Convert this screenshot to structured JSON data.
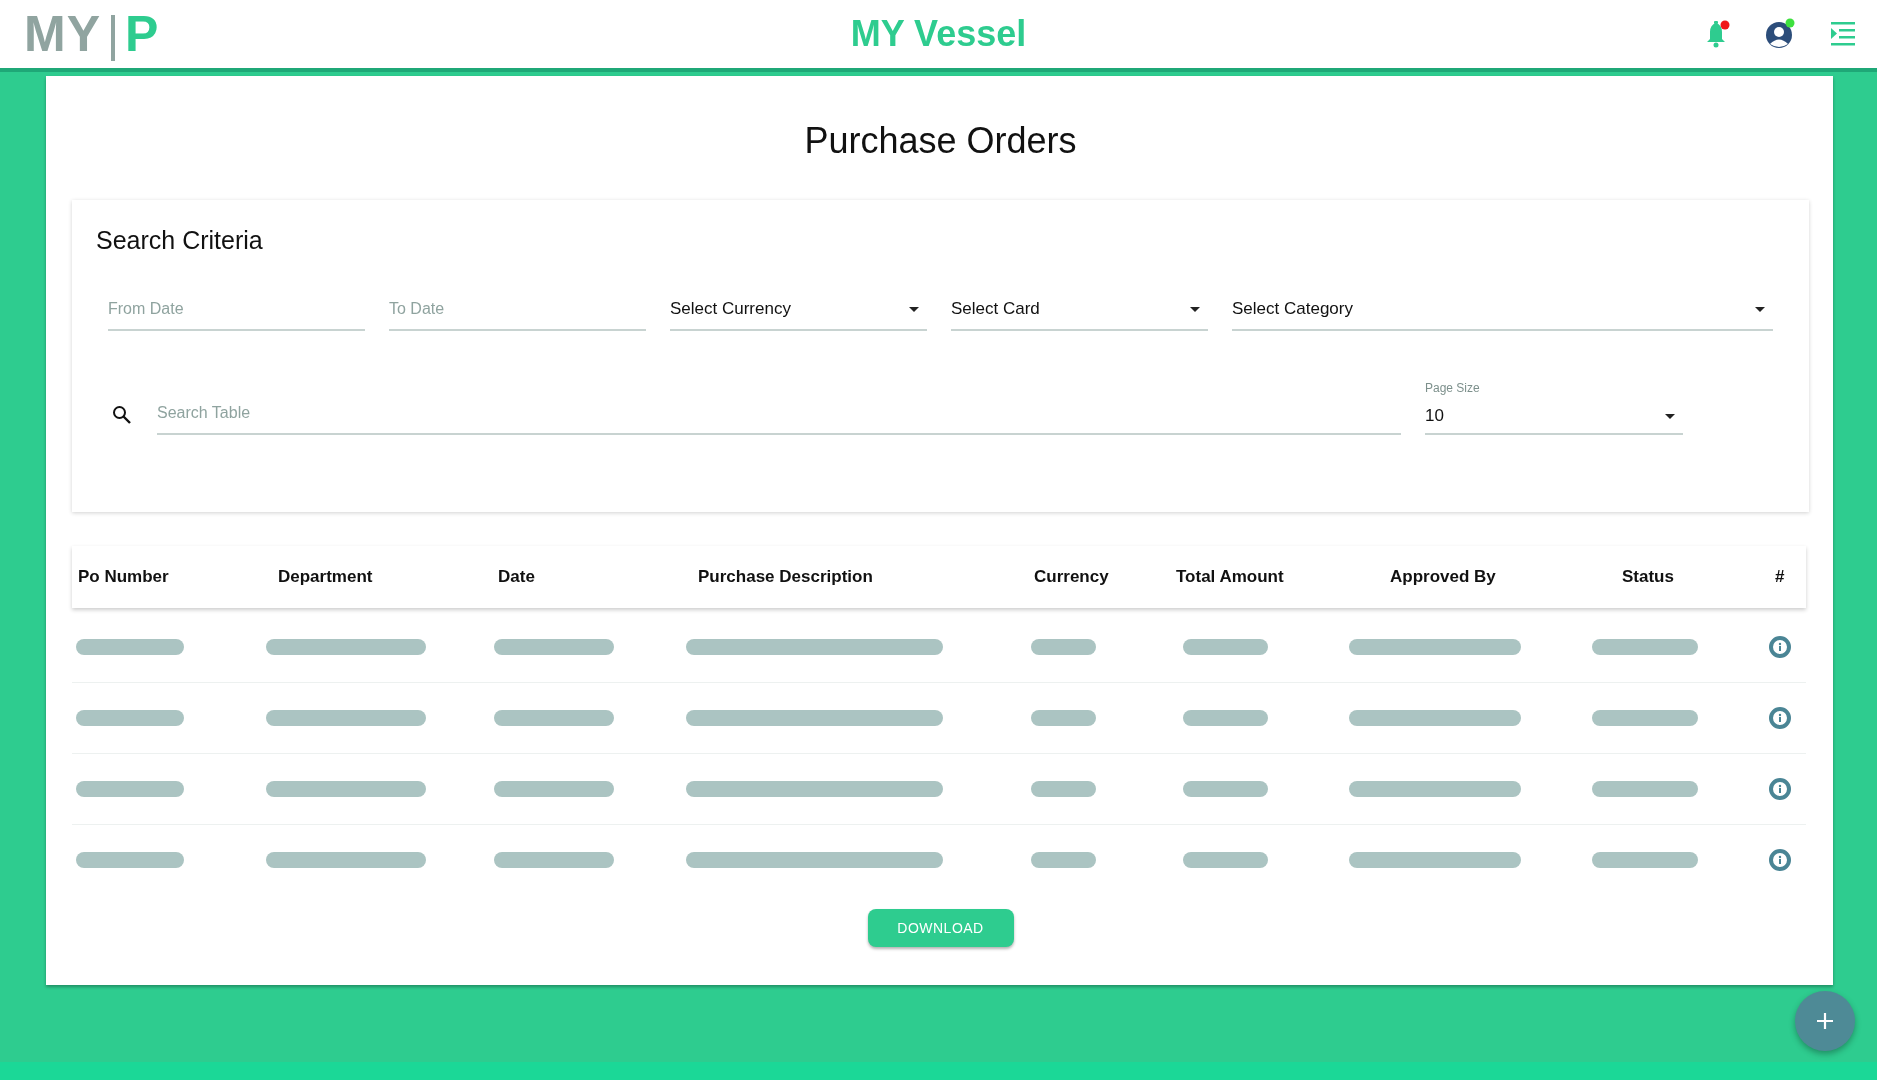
{
  "app": {
    "logo_left": "MY",
    "logo_right": "P",
    "title": "MY Vessel",
    "notifications": {
      "unread": true
    },
    "user": {
      "online": true
    }
  },
  "page": {
    "title": "Purchase Orders"
  },
  "search_criteria": {
    "title": "Search Criteria",
    "fields": [
      {
        "kind": "input",
        "placeholder": "From Date"
      },
      {
        "kind": "input",
        "placeholder": "To Date"
      },
      {
        "kind": "select",
        "value": "Select Currency"
      },
      {
        "kind": "select",
        "value": "Select Card"
      },
      {
        "kind": "select",
        "value": "Select Category"
      }
    ],
    "search": {
      "placeholder": "Search Table"
    },
    "page_size": {
      "label": "Page Size",
      "value": "10"
    }
  },
  "table": {
    "columns": [
      "Po Number",
      "Department",
      "Date",
      "Purchase Description",
      "Currency",
      "Total Amount",
      "Approved By",
      "Status",
      "#"
    ],
    "rows": [
      {
        "loading": true
      },
      {
        "loading": true
      },
      {
        "loading": true
      },
      {
        "loading": true
      }
    ]
  },
  "download_button": "DOWNLOAD"
}
